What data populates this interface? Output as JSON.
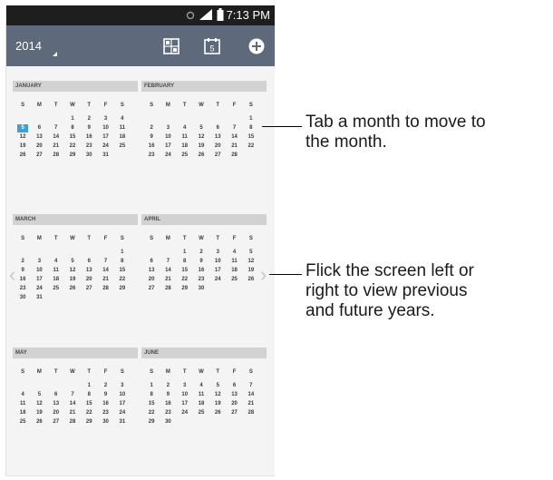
{
  "status_bar": {
    "time": "7:13 PM",
    "icons": [
      "notification-icon",
      "signal-icon",
      "battery-icon"
    ]
  },
  "action_bar": {
    "year": "2014",
    "icons": [
      "month-view-icon",
      "today-icon",
      "add-event-icon"
    ],
    "today_icon_number": "5"
  },
  "weekday_headers": [
    "S",
    "M",
    "T",
    "W",
    "T",
    "F",
    "S"
  ],
  "months": [
    {
      "name": "JANUARY",
      "today_day": "5",
      "weeks": [
        [
          "",
          "",
          "",
          "1",
          "2",
          "3",
          "4"
        ],
        [
          "5",
          "6",
          "7",
          "8",
          "9",
          "10",
          "11"
        ],
        [
          "12",
          "13",
          "14",
          "15",
          "16",
          "17",
          "18"
        ],
        [
          "19",
          "20",
          "21",
          "22",
          "23",
          "24",
          "25"
        ],
        [
          "26",
          "27",
          "28",
          "29",
          "30",
          "31",
          ""
        ]
      ]
    },
    {
      "name": "FEBRUARY",
      "weeks": [
        [
          "",
          "",
          "",
          "",
          "",
          "",
          "1"
        ],
        [
          "2",
          "3",
          "4",
          "5",
          "6",
          "7",
          "8"
        ],
        [
          "9",
          "10",
          "11",
          "12",
          "13",
          "14",
          "15"
        ],
        [
          "16",
          "17",
          "18",
          "19",
          "20",
          "21",
          "22"
        ],
        [
          "23",
          "24",
          "25",
          "26",
          "27",
          "28",
          ""
        ]
      ]
    },
    {
      "name": "MARCH",
      "weeks": [
        [
          "",
          "",
          "",
          "",
          "",
          "",
          "1"
        ],
        [
          "2",
          "3",
          "4",
          "5",
          "6",
          "7",
          "8"
        ],
        [
          "9",
          "10",
          "11",
          "12",
          "13",
          "14",
          "15"
        ],
        [
          "16",
          "17",
          "18",
          "19",
          "20",
          "21",
          "22"
        ],
        [
          "23",
          "24",
          "25",
          "26",
          "27",
          "28",
          "29"
        ],
        [
          "30",
          "31",
          "",
          "",
          "",
          "",
          ""
        ]
      ]
    },
    {
      "name": "APRIL",
      "weeks": [
        [
          "",
          "",
          "1",
          "2",
          "3",
          "4",
          "5"
        ],
        [
          "6",
          "7",
          "8",
          "9",
          "10",
          "11",
          "12"
        ],
        [
          "13",
          "14",
          "15",
          "16",
          "17",
          "18",
          "19"
        ],
        [
          "20",
          "21",
          "22",
          "23",
          "24",
          "25",
          "26"
        ],
        [
          "27",
          "28",
          "29",
          "30",
          "",
          "",
          ""
        ]
      ]
    },
    {
      "name": "MAY",
      "weeks": [
        [
          "",
          "",
          "",
          "",
          "1",
          "2",
          "3"
        ],
        [
          "4",
          "5",
          "6",
          "7",
          "8",
          "9",
          "10"
        ],
        [
          "11",
          "12",
          "13",
          "14",
          "15",
          "16",
          "17"
        ],
        [
          "18",
          "19",
          "20",
          "21",
          "22",
          "23",
          "24"
        ],
        [
          "25",
          "26",
          "27",
          "28",
          "29",
          "30",
          "31"
        ]
      ]
    },
    {
      "name": "JUNE",
      "weeks": [
        [
          "1",
          "2",
          "3",
          "4",
          "5",
          "6",
          "7"
        ],
        [
          "8",
          "9",
          "10",
          "11",
          "12",
          "13",
          "14"
        ],
        [
          "15",
          "16",
          "17",
          "18",
          "19",
          "20",
          "21"
        ],
        [
          "22",
          "23",
          "24",
          "25",
          "26",
          "27",
          "28"
        ],
        [
          "29",
          "30",
          "",
          "",
          "",
          "",
          ""
        ]
      ]
    }
  ],
  "nav": {
    "prev_glyph": "‹",
    "next_glyph": "›"
  },
  "annotations": {
    "top": "Tab a month to move to\nthe month.",
    "middle": "Flick the screen left or\nright to view previous\nand future years."
  },
  "colors": {
    "action_bar": "#5e6a7b",
    "today_highlight": "#3fa0d8",
    "month_header": "#d2d2d2"
  }
}
